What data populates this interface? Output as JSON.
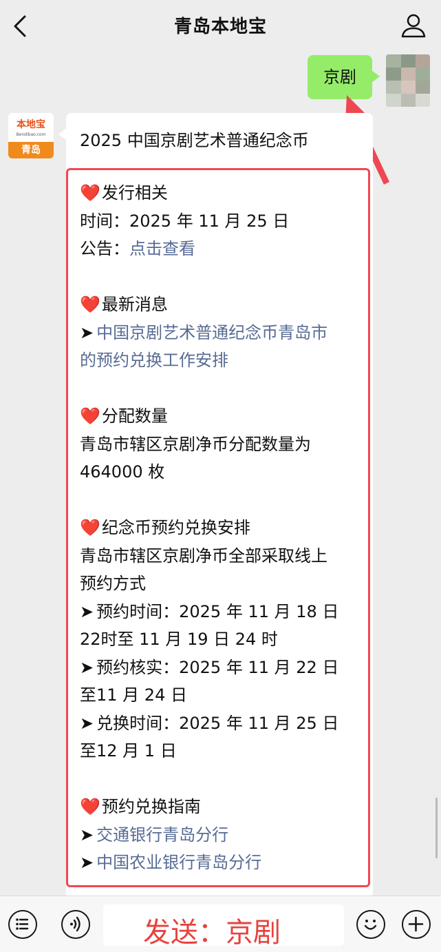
{
  "header": {
    "title": "青岛本地宝"
  },
  "outgoing": {
    "text": "京剧"
  },
  "bot": {
    "avatar_brand": "本地宝",
    "avatar_domain": "Bendibao.com",
    "avatar_city": "青岛"
  },
  "article": {
    "title": "2025 中国京剧艺术普通纪念币",
    "s1": {
      "heading": "发行相关",
      "time": "时间：2025 年 11 月 25 日",
      "notice_label": "公告：",
      "notice_link": "点击查看"
    },
    "s2": {
      "heading": "最新消息",
      "link_line1": "中国京剧艺术普通纪念币青岛市",
      "link_line2": "的预约兑换工作安排"
    },
    "s3": {
      "heading": "分配数量",
      "line1": "青岛市辖区京剧净币分配数量为",
      "line2": "464000 枚"
    },
    "s4": {
      "heading": "纪念币预约兑换安排",
      "line1": "青岛市辖区京剧净币全部采取线上",
      "line2": "预约方式",
      "b1a": "预约时间：2025 年 11 月 18 日",
      "b1b": "22时至 11 月 19 日 24 时",
      "b2a": "预约核实：2025 年 11 月 22 日",
      "b2b": "至11 月 24 日",
      "b3a": "兑换时间：2025 年 11 月 25 日",
      "b3b": "至12 月 1 日"
    },
    "s5": {
      "heading": "预约兑换指南",
      "link1": "交通银行青岛分行",
      "link2": "中国农业银行青岛分行"
    }
  },
  "input": {
    "text": "发送：京剧"
  },
  "colors": {
    "accent_red": "#ee4852",
    "link": "#576b95",
    "outgoing_bubble": "#95ec69"
  },
  "icons": {
    "heart": "❤️",
    "bullet": "➤"
  }
}
